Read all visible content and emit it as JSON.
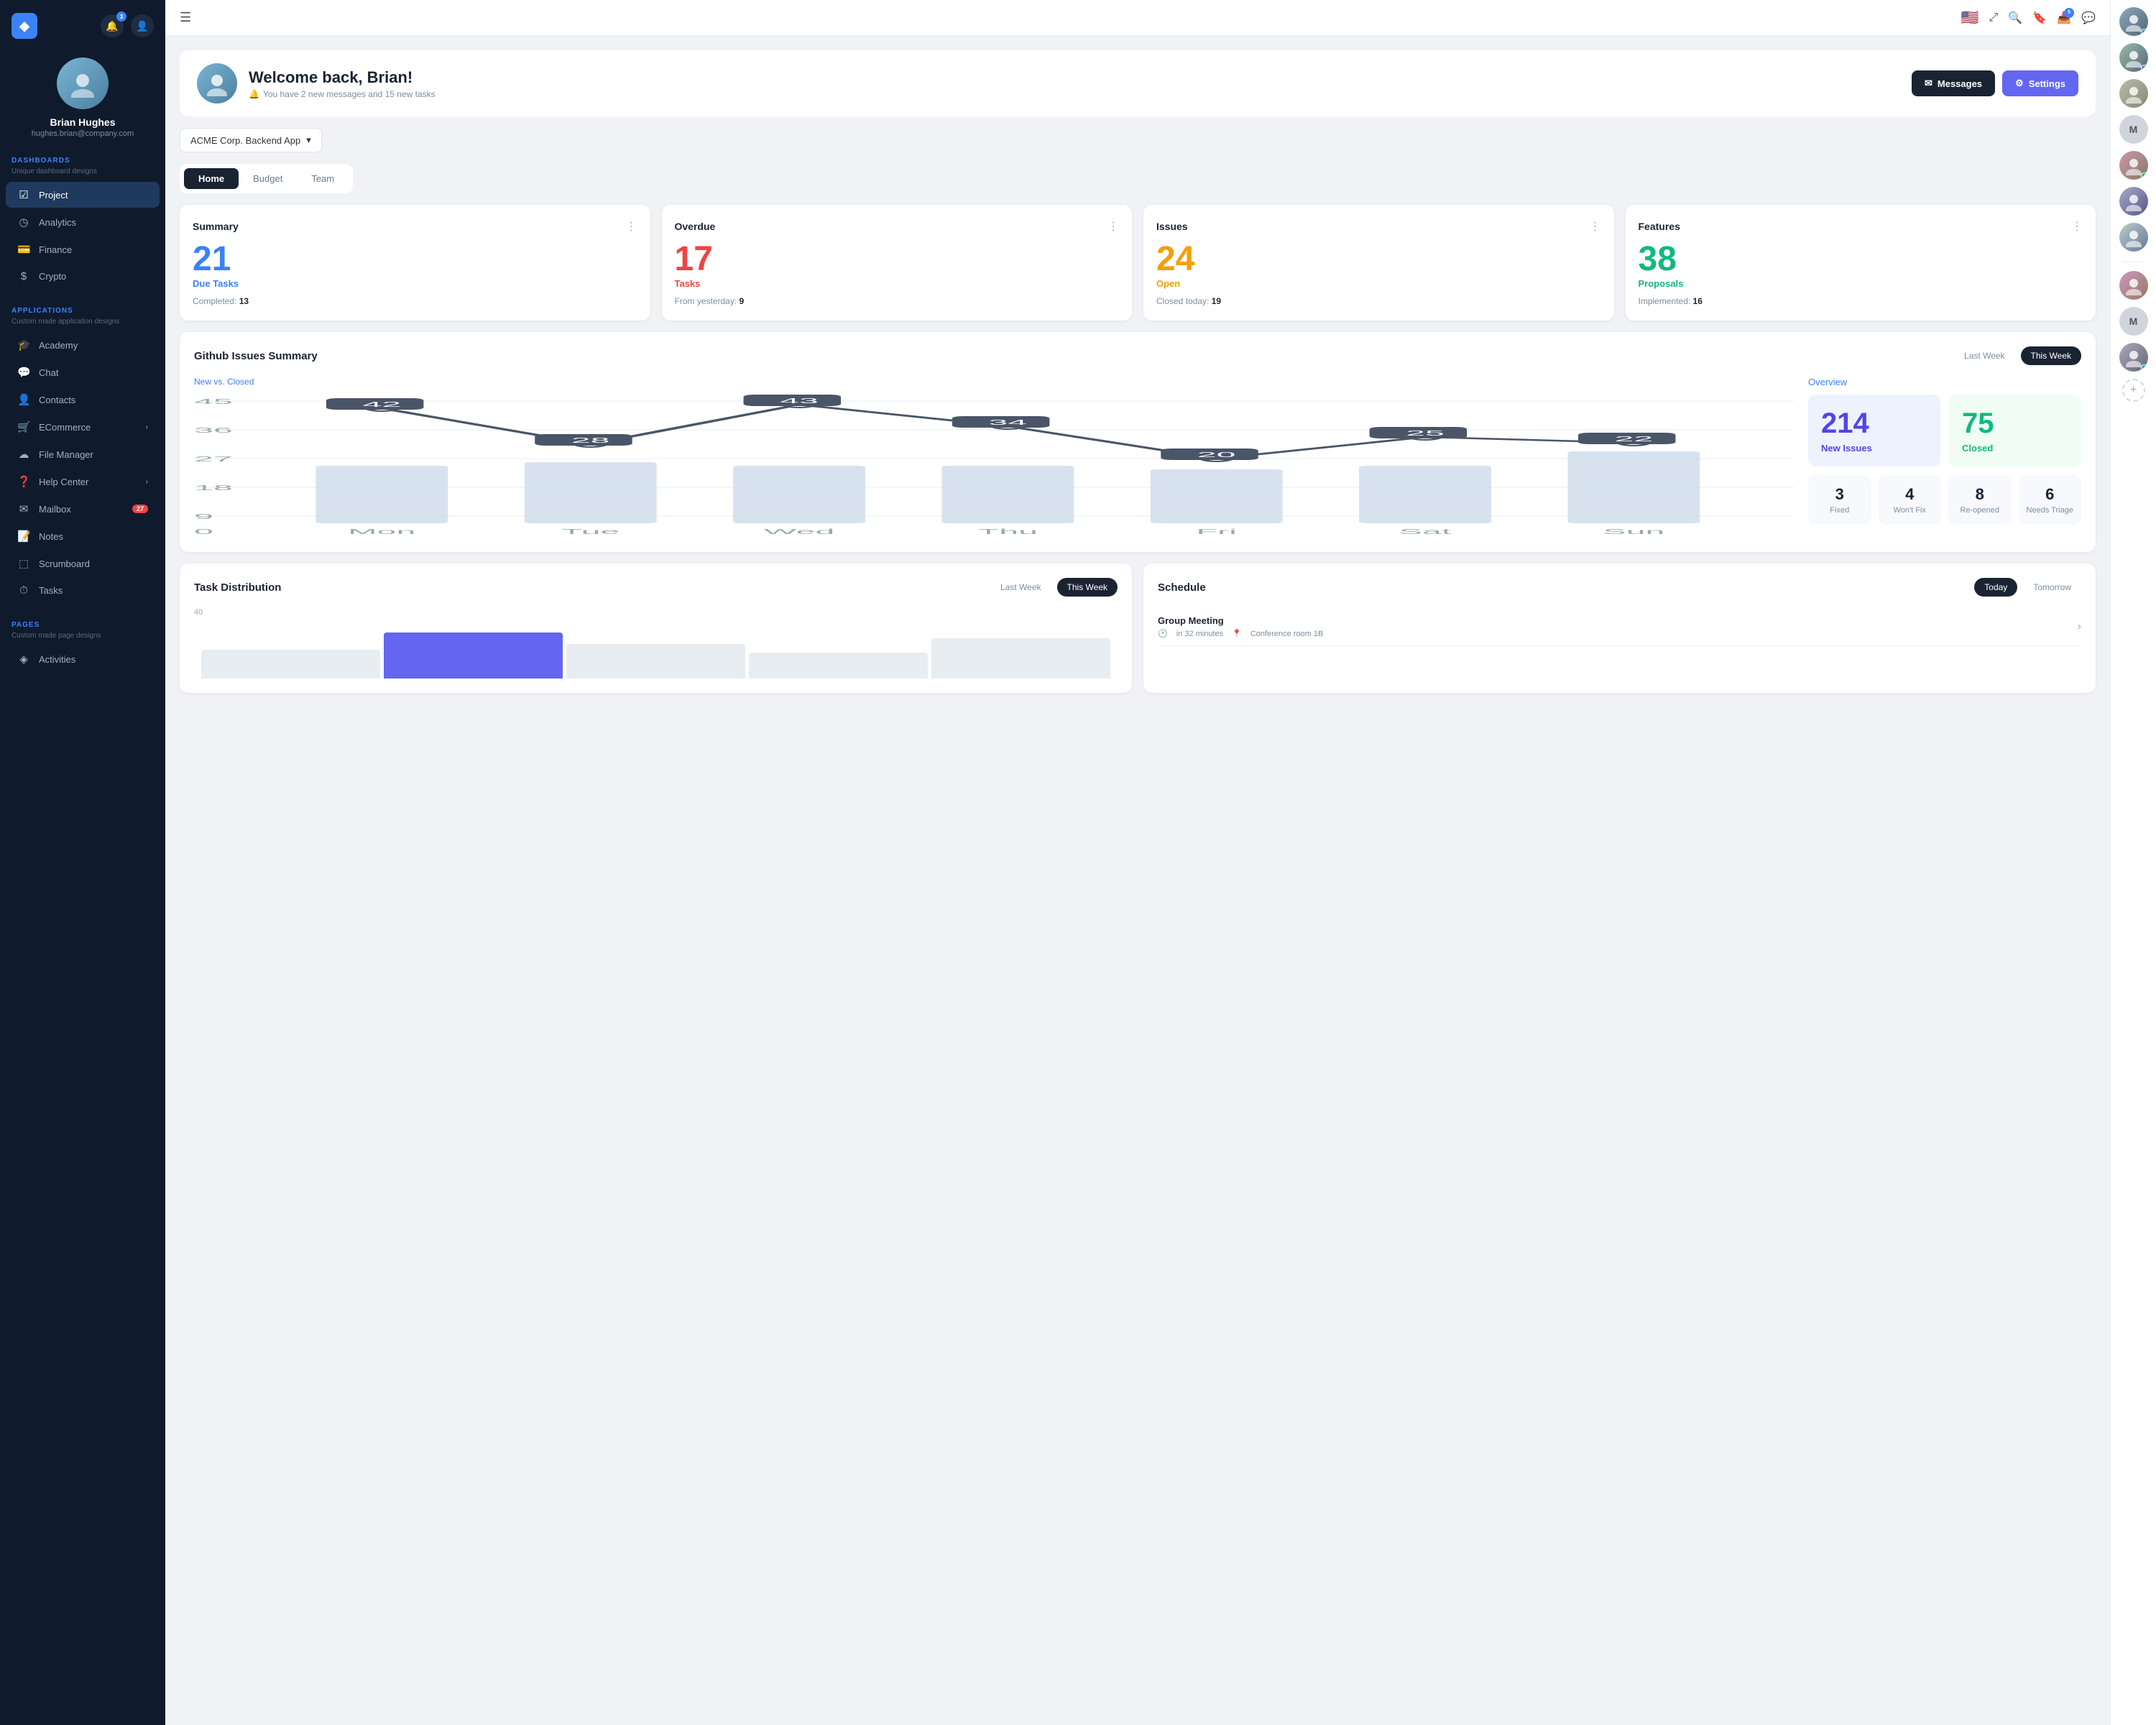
{
  "sidebar": {
    "logo": "◆",
    "notification_count": "3",
    "user": {
      "name": "Brian Hughes",
      "email": "hughes.brian@company.com"
    },
    "sections": [
      {
        "label": "DASHBOARDS",
        "sublabel": "Unique dashboard designs",
        "items": [
          {
            "id": "project",
            "icon": "☑",
            "label": "Project",
            "active": true
          },
          {
            "id": "analytics",
            "icon": "◷",
            "label": "Analytics"
          },
          {
            "id": "finance",
            "icon": "💳",
            "label": "Finance"
          },
          {
            "id": "crypto",
            "icon": "$",
            "label": "Crypto"
          }
        ]
      },
      {
        "label": "APPLICATIONS",
        "sublabel": "Custom made application designs",
        "items": [
          {
            "id": "academy",
            "icon": "🎓",
            "label": "Academy"
          },
          {
            "id": "chat",
            "icon": "💬",
            "label": "Chat"
          },
          {
            "id": "contacts",
            "icon": "👤",
            "label": "Contacts"
          },
          {
            "id": "ecommerce",
            "icon": "🛒",
            "label": "ECommerce",
            "arrow": "›"
          },
          {
            "id": "filemanager",
            "icon": "☁",
            "label": "File Manager"
          },
          {
            "id": "helpcenter",
            "icon": "❓",
            "label": "Help Center",
            "arrow": "›"
          },
          {
            "id": "mailbox",
            "icon": "✉",
            "label": "Mailbox",
            "badge": "27"
          },
          {
            "id": "notes",
            "icon": "📝",
            "label": "Notes"
          },
          {
            "id": "scrumboard",
            "icon": "⬚",
            "label": "Scrumboard"
          },
          {
            "id": "tasks",
            "icon": "⏱",
            "label": "Tasks"
          }
        ]
      },
      {
        "label": "PAGES",
        "sublabel": "Custom made page designs",
        "items": [
          {
            "id": "activities",
            "icon": "◈",
            "label": "Activities"
          }
        ]
      }
    ]
  },
  "topbar": {
    "menu_icon": "☰",
    "flag": "🇺🇸",
    "icons": [
      "⤢",
      "🔍",
      "🔖",
      "📥",
      "💬"
    ]
  },
  "welcome": {
    "title": "Welcome back, Brian!",
    "subtitle": "You have 2 new messages and 15 new tasks",
    "messages_btn": "Messages",
    "settings_btn": "Settings"
  },
  "app_selector": {
    "label": "ACME Corp. Backend App"
  },
  "tabs": [
    "Home",
    "Budget",
    "Team"
  ],
  "active_tab": "Home",
  "cards": [
    {
      "id": "summary",
      "title": "Summary",
      "big_number": "21",
      "big_color": "blue",
      "label": "Due Tasks",
      "label_color": "blue",
      "sub_key": "Completed:",
      "sub_val": "13"
    },
    {
      "id": "overdue",
      "title": "Overdue",
      "big_number": "17",
      "big_color": "red",
      "label": "Tasks",
      "label_color": "red",
      "sub_key": "From yesterday:",
      "sub_val": "9"
    },
    {
      "id": "issues",
      "title": "Issues",
      "big_number": "24",
      "big_color": "orange",
      "label": "Open",
      "label_color": "orange",
      "sub_key": "Closed today:",
      "sub_val": "19"
    },
    {
      "id": "features",
      "title": "Features",
      "big_number": "38",
      "big_color": "green",
      "label": "Proposals",
      "label_color": "green",
      "sub_key": "Implemented:",
      "sub_val": "16"
    }
  ],
  "github_section": {
    "title": "Github Issues Summary",
    "last_week_btn": "Last Week",
    "this_week_btn": "This Week",
    "chart_label": "New vs. Closed",
    "overview_label": "Overview",
    "chart_data": {
      "days": [
        "Mon",
        "Tue",
        "Wed",
        "Thu",
        "Fri",
        "Sat",
        "Sun"
      ],
      "line_values": [
        42,
        28,
        43,
        34,
        20,
        25,
        22
      ],
      "bar_heights": [
        65,
        70,
        60,
        65,
        55,
        62,
        80
      ]
    },
    "overview": {
      "new_issues": "214",
      "new_issues_label": "New Issues",
      "closed": "75",
      "closed_label": "Closed",
      "stats": [
        {
          "num": "3",
          "label": "Fixed"
        },
        {
          "num": "4",
          "label": "Won't Fix"
        },
        {
          "num": "8",
          "label": "Re-opened"
        },
        {
          "num": "6",
          "label": "Needs Triage"
        }
      ]
    }
  },
  "task_distribution": {
    "title": "Task Distribution",
    "last_week_btn": "Last Week",
    "this_week_btn": "This Week",
    "max_value": "40"
  },
  "schedule": {
    "title": "Schedule",
    "today_btn": "Today",
    "tomorrow_btn": "Tomorrow",
    "items": [
      {
        "title": "Group Meeting",
        "time": "in 32 minutes",
        "location": "Conference room 1B"
      }
    ]
  },
  "right_panel": {
    "avatars": [
      {
        "id": 1,
        "initials": "👤",
        "status": "online"
      },
      {
        "id": 2,
        "initials": "👤",
        "status": "online"
      },
      {
        "id": 3,
        "initials": "👤",
        "status": "none"
      },
      {
        "id": 4,
        "initials": "M",
        "status": "none"
      },
      {
        "id": 5,
        "initials": "👤",
        "status": "online"
      },
      {
        "id": 6,
        "initials": "👤",
        "status": "none"
      },
      {
        "id": 7,
        "initials": "👤",
        "status": "online"
      },
      {
        "id": 8,
        "initials": "👤",
        "status": "none"
      },
      {
        "id": 9,
        "initials": "M",
        "status": "none"
      },
      {
        "id": 10,
        "initials": "👤",
        "status": "online"
      }
    ]
  }
}
